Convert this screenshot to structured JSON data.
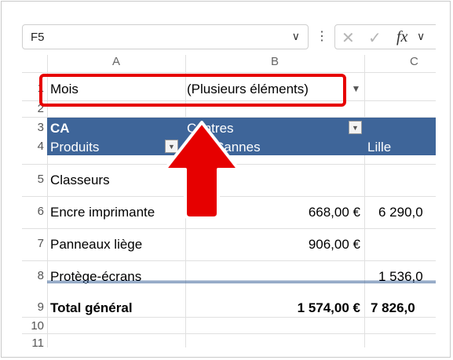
{
  "formula_bar": {
    "name_box": "F5",
    "fx_label": "fx"
  },
  "columns": [
    "A",
    "B",
    "C"
  ],
  "rows": [
    "1",
    "2",
    "3",
    "4",
    "5",
    "6",
    "7",
    "8",
    "9",
    "10",
    "11"
  ],
  "filter": {
    "label": "Mois",
    "value": "(Plusieurs éléments)"
  },
  "pivot": {
    "values_label": "CA",
    "columns_label": "Centres",
    "rows_label": "Produits",
    "col_headers": [
      "Cannes",
      "Lille"
    ],
    "body": [
      {
        "label": "Classeurs",
        "cannes": "",
        "lille": ""
      },
      {
        "label": "Encre imprimante",
        "cannes": "668,00 €",
        "lille": "6 290,0"
      },
      {
        "label": "Panneaux liège",
        "cannes": "906,00 €",
        "lille": ""
      },
      {
        "label": "Protège-écrans",
        "cannes": "",
        "lille": "1 536,0"
      }
    ],
    "total": {
      "label": "Total général",
      "cannes": "1 574,00 €",
      "lille": "7 826,0"
    }
  },
  "colors": {
    "pivot_header": "#3e6599",
    "highlight": "#e60000"
  }
}
